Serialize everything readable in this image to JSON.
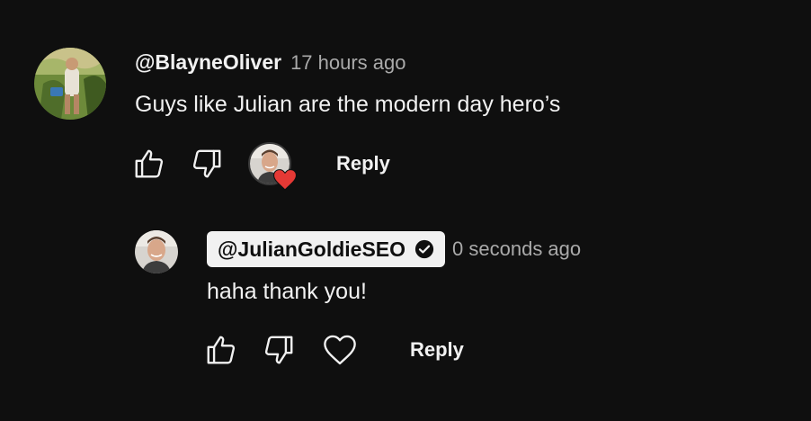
{
  "comment": {
    "author": "@BlayneOliver",
    "time": "17 hours ago",
    "text": "Guys like Julian are the modern day hero’s",
    "reply_label": "Reply",
    "icons": {
      "like": "thumbs-up-icon",
      "dislike": "thumbs-down-icon",
      "creator_heart": "creator-heart-icon"
    }
  },
  "reply": {
    "author": "@JulianGoldieSEO",
    "verified": true,
    "time": "0 seconds ago",
    "text": "haha thank you!",
    "reply_label": "Reply",
    "icons": {
      "like": "thumbs-up-icon",
      "dislike": "thumbs-down-icon",
      "heart": "heart-outline-icon"
    }
  },
  "colors": {
    "background": "#0f0f0f",
    "text": "#f1f1f1",
    "secondary_text": "#aaaaaa",
    "owner_chip": "#f1f1f1",
    "heart_red": "#e53935"
  }
}
